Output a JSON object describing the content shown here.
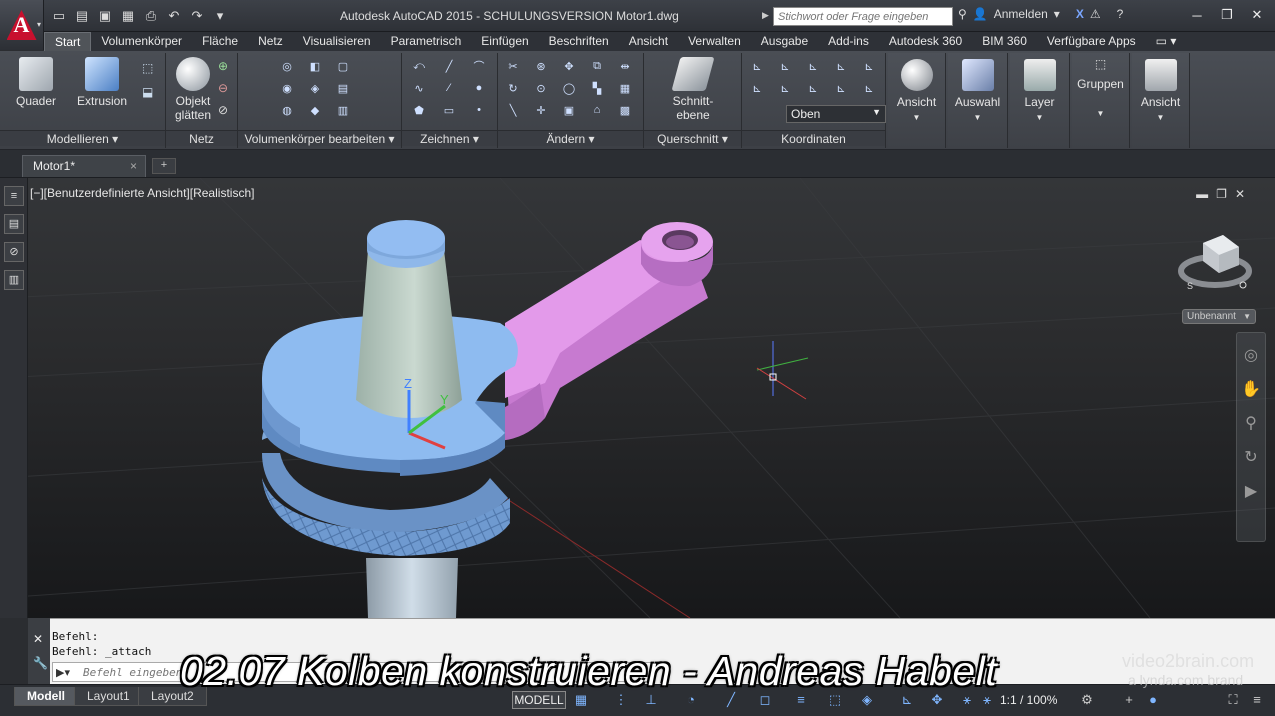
{
  "app": {
    "logo_letter": "A",
    "title": "Autodesk AutoCAD 2015 - SCHULUNGSVERSION    Motor1.dwg",
    "search_placeholder": "Stichwort oder Frage eingeben",
    "login_label": "Anmelden",
    "accent_color": "#c8102e"
  },
  "qat_icons": [
    "new-icon",
    "open-icon",
    "save-icon",
    "saveas-icon",
    "print-icon",
    "undo-icon",
    "redo-icon",
    "customize-icon"
  ],
  "ribbon_tabs": [
    {
      "label": "Start",
      "active": true
    },
    {
      "label": "Volumenkörper",
      "active": false
    },
    {
      "label": "Fläche",
      "active": false
    },
    {
      "label": "Netz",
      "active": false
    },
    {
      "label": "Visualisieren",
      "active": false
    },
    {
      "label": "Parametrisch",
      "active": false
    },
    {
      "label": "Einfügen",
      "active": false
    },
    {
      "label": "Beschriften",
      "active": false
    },
    {
      "label": "Ansicht",
      "active": false
    },
    {
      "label": "Verwalten",
      "active": false
    },
    {
      "label": "Ausgabe",
      "active": false
    },
    {
      "label": "Add-ins",
      "active": false
    },
    {
      "label": "Autodesk 360",
      "active": false
    },
    {
      "label": "BIM 360",
      "active": false
    },
    {
      "label": "Verfügbare Apps",
      "active": false
    }
  ],
  "ribbon": {
    "panels": {
      "modellieren": {
        "title": "Modellieren ▾",
        "quader": "Quader",
        "extrusion": "Extrusion"
      },
      "netz": {
        "title": "Netz",
        "objekt": "Objekt",
        "glaetten": "glätten"
      },
      "volumen": {
        "title": "Volumenkörper bearbeiten ▾"
      },
      "zeichnen": {
        "title": "Zeichnen ▾"
      },
      "aendern": {
        "title": "Ändern ▾"
      },
      "querschnitt": {
        "title": "Querschnitt ▾",
        "schnitt": "Schnitt-",
        "ebene": "ebene"
      },
      "koordinaten": {
        "title": "Koordinaten",
        "oben": "Oben"
      }
    },
    "side_buttons": [
      "Ansicht",
      "Auswahl",
      "Layer",
      "Gruppen",
      "Ansicht"
    ]
  },
  "file_tab": {
    "label": "Motor1*",
    "close": "×",
    "new": "+"
  },
  "viewport": {
    "view_label": "[−][Benutzerdefinierte Ansicht][Realistisch]",
    "named_view": "Unbenannt",
    "axis_labels": {
      "z": "Z",
      "y": "Y"
    },
    "ucs_colors": {
      "x": "#e04040",
      "y": "#40c040",
      "z": "#4080ff"
    },
    "part_colors": {
      "crank": "#7fb0e8",
      "rod": "#d88ae0",
      "pin": "#b5c8d8"
    }
  },
  "command": {
    "lines": [
      "Befehl:",
      "Befehl: _attach"
    ],
    "placeholder": "Befehl eingeben"
  },
  "status": {
    "layout_tabs": [
      {
        "label": "Modell",
        "active": true
      },
      {
        "label": "Layout1",
        "active": false
      },
      {
        "label": "Layout2",
        "active": false
      }
    ],
    "model_label": "MODELL",
    "scale": "1:1 / 100%"
  },
  "overlay": {
    "caption": "02.07 Kolben konstruieren - Andreas Habelt",
    "brand_line1": "video2brain.com",
    "brand_line2": "a lynda.com brand"
  }
}
